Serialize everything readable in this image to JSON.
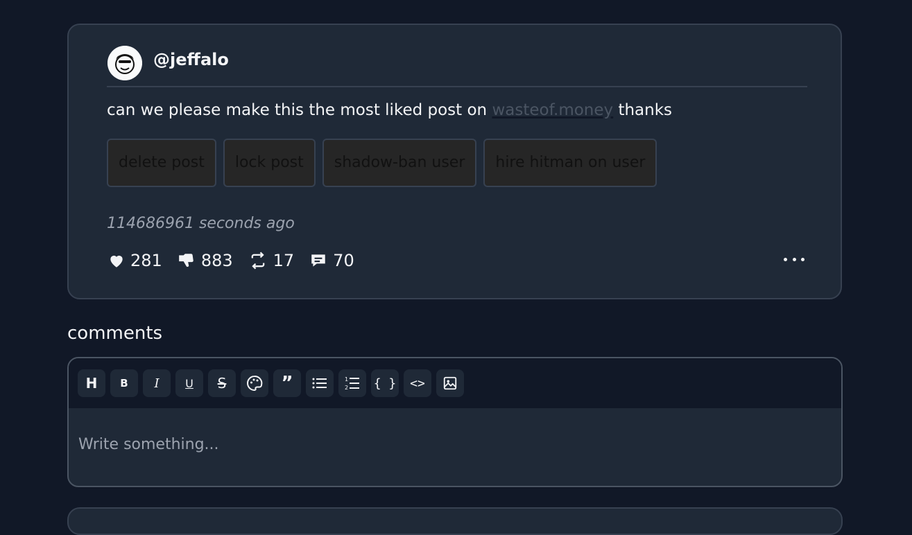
{
  "post": {
    "username": "@jeffalo",
    "text_before": "can we please make this the most liked post on ",
    "link_text": "wasteof.money",
    "text_after": " thanks",
    "mod_buttons": [
      "delete post",
      "lock post",
      "shadow-ban user",
      "hire hitman on user"
    ],
    "timestamp": "114686961 seconds ago",
    "stats": {
      "likes": "281",
      "dislikes": "883",
      "reposts": "17",
      "comments": "70"
    }
  },
  "comments": {
    "heading": "comments",
    "placeholder": "Write something...",
    "toolbar": [
      {
        "icon": "heading-icon",
        "label": "H"
      },
      {
        "icon": "bold-icon",
        "label": "B"
      },
      {
        "icon": "italic-icon",
        "label": "I"
      },
      {
        "icon": "underline-icon",
        "label": "U"
      },
      {
        "icon": "strikethrough-icon",
        "label": "S"
      },
      {
        "icon": "palette-icon",
        "label": ""
      },
      {
        "icon": "quote-icon",
        "label": "”"
      },
      {
        "icon": "bullet-list-icon",
        "label": ""
      },
      {
        "icon": "ordered-list-icon",
        "label": ""
      },
      {
        "icon": "code-block-icon",
        "label": "{ }"
      },
      {
        "icon": "code-icon",
        "label": "<>"
      },
      {
        "icon": "image-icon",
        "label": ""
      }
    ]
  }
}
